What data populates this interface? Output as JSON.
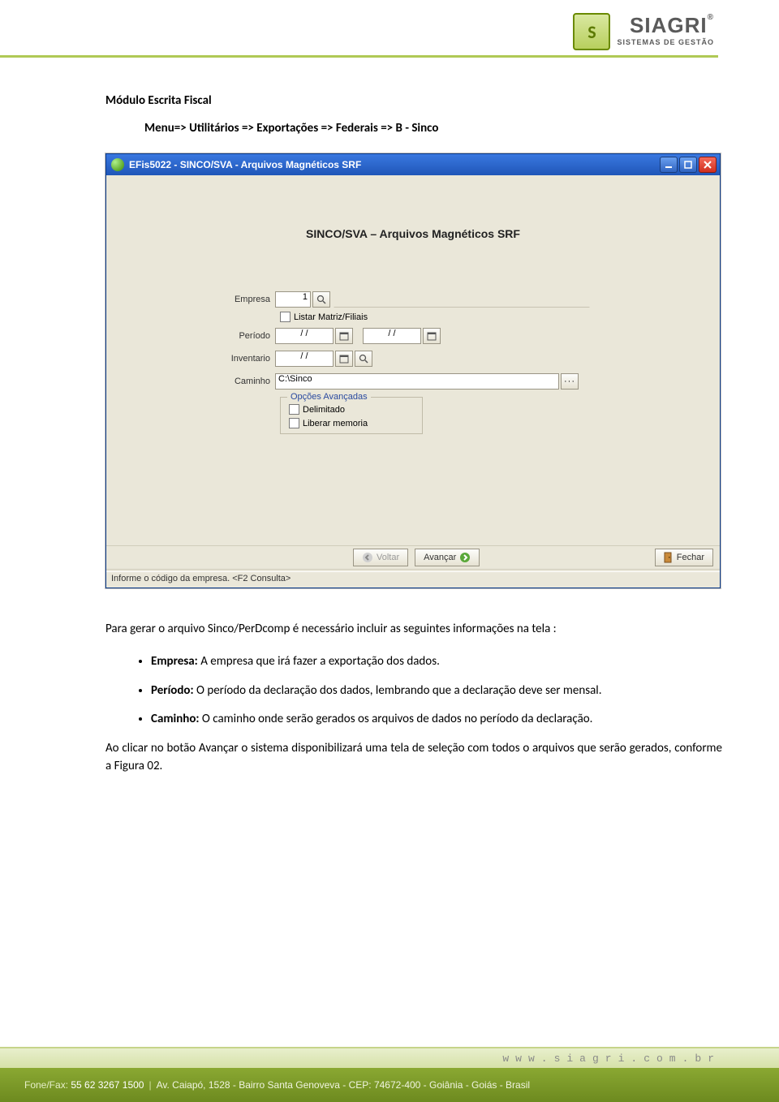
{
  "logo": {
    "brand": "SIAGRI",
    "mark": "S",
    "tagline": "SISTEMAS DE GESTÃO",
    "reg": "®"
  },
  "doc": {
    "module_title": "Módulo Escrita Fiscal",
    "menu_path": "Menu=> Utilitários => Exportações => Federais => B - Sinco"
  },
  "win": {
    "title": "EFis5022 - SINCO/SVA - Arquivos Magnéticos SRF",
    "form_title": "SINCO/SVA – Arquivos Magnéticos SRF",
    "labels": {
      "empresa": "Empresa",
      "periodo": "Período",
      "inventario": "Inventario",
      "caminho": "Caminho"
    },
    "values": {
      "empresa": "1",
      "date_ph": "/  /",
      "caminho": "C:\\Sinco"
    },
    "checkbox_listar": "Listar Matriz/Filiais",
    "advanced_legend": "Opções Avançadas",
    "advanced_opts": {
      "delimitado": "Delimitado",
      "liberar": "Liberar memoria"
    },
    "buttons": {
      "voltar": "Voltar",
      "avancar": "Avançar",
      "fechar": "Fechar"
    },
    "status": "Informe o código da empresa. <F2 Consulta>"
  },
  "body_text": {
    "intro": "Para gerar o arquivo Sinco/PerDcomp é necessário incluir as seguintes informações na tela :",
    "bullets": {
      "empresa_b": "Empresa:",
      "empresa_t": " A empresa que irá fazer a exportação dos dados.",
      "periodo_b": "Período:",
      "periodo_t": " O período da declaração dos dados, lembrando que a declaração deve ser mensal.",
      "caminho_b": "Caminho:",
      "caminho_t": " O caminho onde serão gerados os arquivos de dados no período da declaração."
    },
    "closing": "Ao clicar no botão Avançar o sistema disponibilizará uma tela de seleção com todos o arquivos que serão gerados, conforme a Figura 02."
  },
  "footer": {
    "site": "www.siagri.com.br",
    "phone_label": "Fone/Fax:",
    "phone": "55 62 3267 1500",
    "address": "Av. Caiapó, 1528 - Bairro Santa Genoveva - CEP: 74672-400 - Goiânia - Goiás - Brasil"
  }
}
